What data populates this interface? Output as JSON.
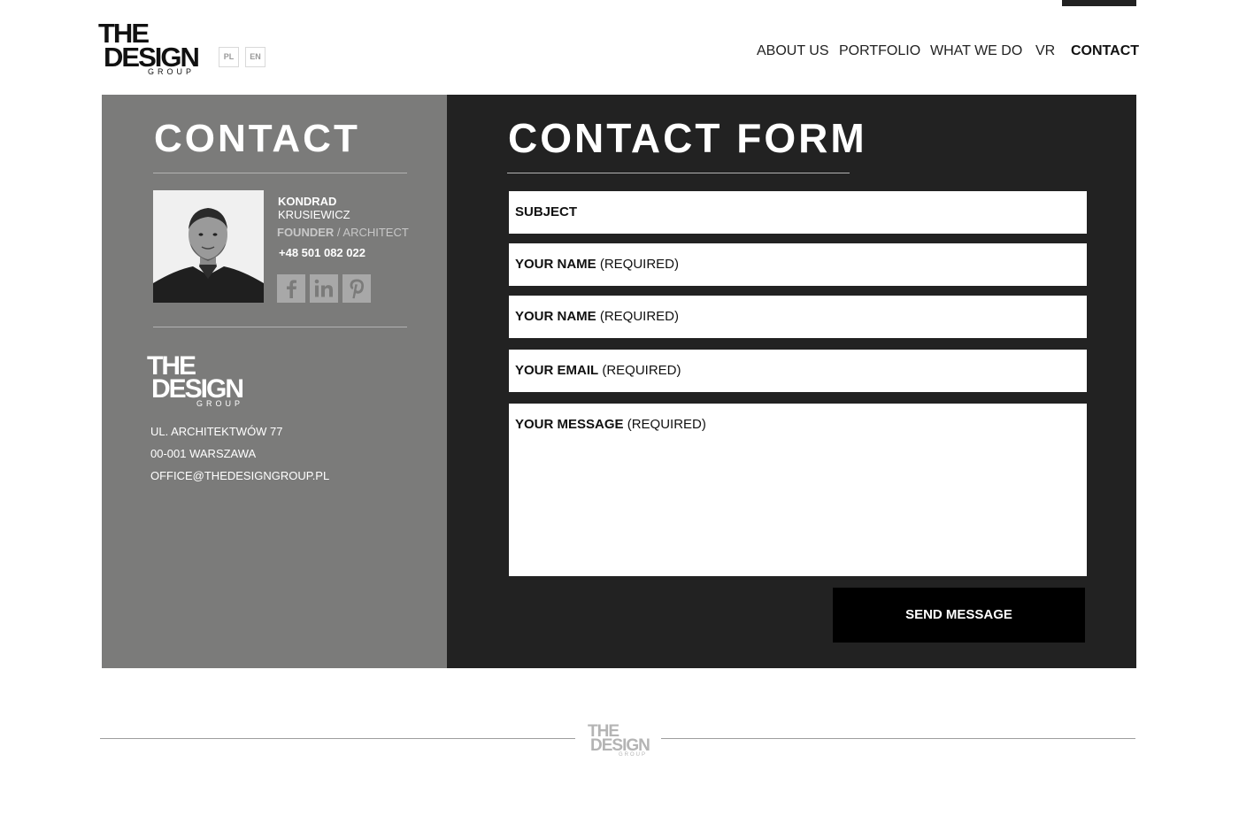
{
  "brand": {
    "line1": "THE",
    "line2": "DESIGN",
    "line3": "GROUP"
  },
  "languages": [
    "PL",
    "EN"
  ],
  "nav": [
    {
      "label": "ABOUT US"
    },
    {
      "label": "PORTFOLIO"
    },
    {
      "label": "WHAT WE DO"
    },
    {
      "label": "VR"
    },
    {
      "label": "CONTACT",
      "active": true
    }
  ],
  "contact": {
    "heading": "CONTACT",
    "person": {
      "first_name": "KONDRAD",
      "last_name": "KRUSIEWICZ",
      "role_primary": "FOUNDER",
      "role_separator": " / ",
      "role_secondary": "ARCHITECT",
      "phone": "+48 501 082 022"
    },
    "social": [
      {
        "icon": "facebook-icon"
      },
      {
        "icon": "linkedin-icon"
      },
      {
        "icon": "pinterest-icon"
      }
    ],
    "address": {
      "street": "UL. ARCHITEKTWÓW 77",
      "city": "00-001 WARSZAWA",
      "email": "OFFICE@THEDESIGNGROUP.PL"
    }
  },
  "form": {
    "heading": "CONTACT FORM",
    "fields": [
      {
        "label": "SUBJECT",
        "suffix": ""
      },
      {
        "label": "YOUR NAME",
        "suffix": " (REQUIRED)"
      },
      {
        "label": "YOUR NAME",
        "suffix": " (REQUIRED)"
      },
      {
        "label": "YOUR EMAIL",
        "suffix": " (REQUIRED)"
      },
      {
        "label": "YOUR MESSAGE",
        "suffix": " (REQUIRED)"
      }
    ],
    "submit_label": "SEND MESSAGE"
  },
  "colors": {
    "left_panel": "#7b7b7a",
    "right_panel": "#222222",
    "button": "#000000",
    "text_light": "#ffffff"
  }
}
